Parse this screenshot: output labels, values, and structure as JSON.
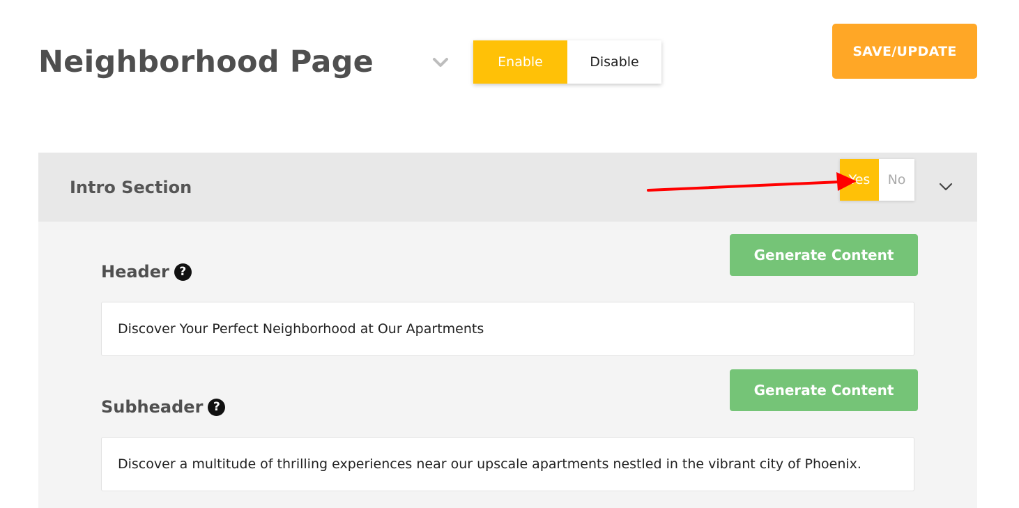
{
  "page": {
    "title": "Neighborhood Page",
    "enable_label": "Enable",
    "disable_label": "Disable",
    "save_label": "SAVE/UPDATE"
  },
  "intro_section": {
    "title": "Intro Section",
    "yes_label": "Yes",
    "no_label": "No",
    "fields": [
      {
        "label": "Header",
        "generate_label": "Generate Content",
        "value": "Discover Your Perfect Neighborhood at Our Apartments"
      },
      {
        "label": "Subheader",
        "generate_label": "Generate Content",
        "value": "Discover a multitude of thrilling experiences near our upscale apartments nestled in the vibrant city of Phoenix."
      }
    ]
  },
  "icons": {
    "help": "?",
    "chevron": "chevron-down-icon",
    "annotation_arrow": "red-arrow-icon"
  },
  "colors": {
    "accent_yellow": "#ffc107",
    "save_orange": "#ffa726",
    "generate_green": "#75c477",
    "arrow_red": "#ff0000"
  }
}
